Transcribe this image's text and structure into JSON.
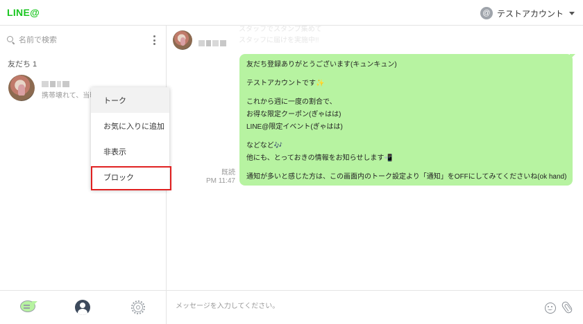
{
  "header": {
    "logo": "LINE@",
    "account_icon": "@",
    "account_name": "テストアカウント",
    "caret_icon": "caret-down-icon"
  },
  "sidebar": {
    "search_placeholder": "名前で検索",
    "section_label": "友だち 1",
    "friend": {
      "status": "携帯壊れて、当時"
    },
    "context_menu": [
      {
        "label": "トーク",
        "active": true
      },
      {
        "label": "お気に入りに追加",
        "active": false
      },
      {
        "label": "非表示",
        "active": false
      },
      {
        "label": "ブロック",
        "active": false,
        "highlighted": true
      }
    ],
    "nav": [
      "chat-icon",
      "friends-icon",
      "gear-icon"
    ]
  },
  "chat": {
    "faded_lines": [
      "スタッフでスタンプ集めて",
      "スタッフに届けを実施中!!"
    ],
    "message_lines": [
      "友だち登録ありがとうございます(キュンキュン)",
      "",
      "テストアカウントです✨",
      "",
      "これから週に一度の割合で、",
      "お得な限定クーポン(ぎゃはは)",
      "LINE@限定イベント(ぎゃはは)",
      "",
      "などなど🎶",
      "他にも、とっておきの情報をお知らせします📲",
      "",
      "通知が多いと感じた方は、この画面内のトーク設定より「通知」をOFFにしてみてくださいね(ok hand)"
    ],
    "read_label": "既読",
    "time": "PM 11:47",
    "composer_placeholder": "メッセージを入力してください。"
  },
  "colors": {
    "brand": "#19c61f",
    "bubble": "#b7f3a1",
    "highlight_border": "#e02020"
  }
}
